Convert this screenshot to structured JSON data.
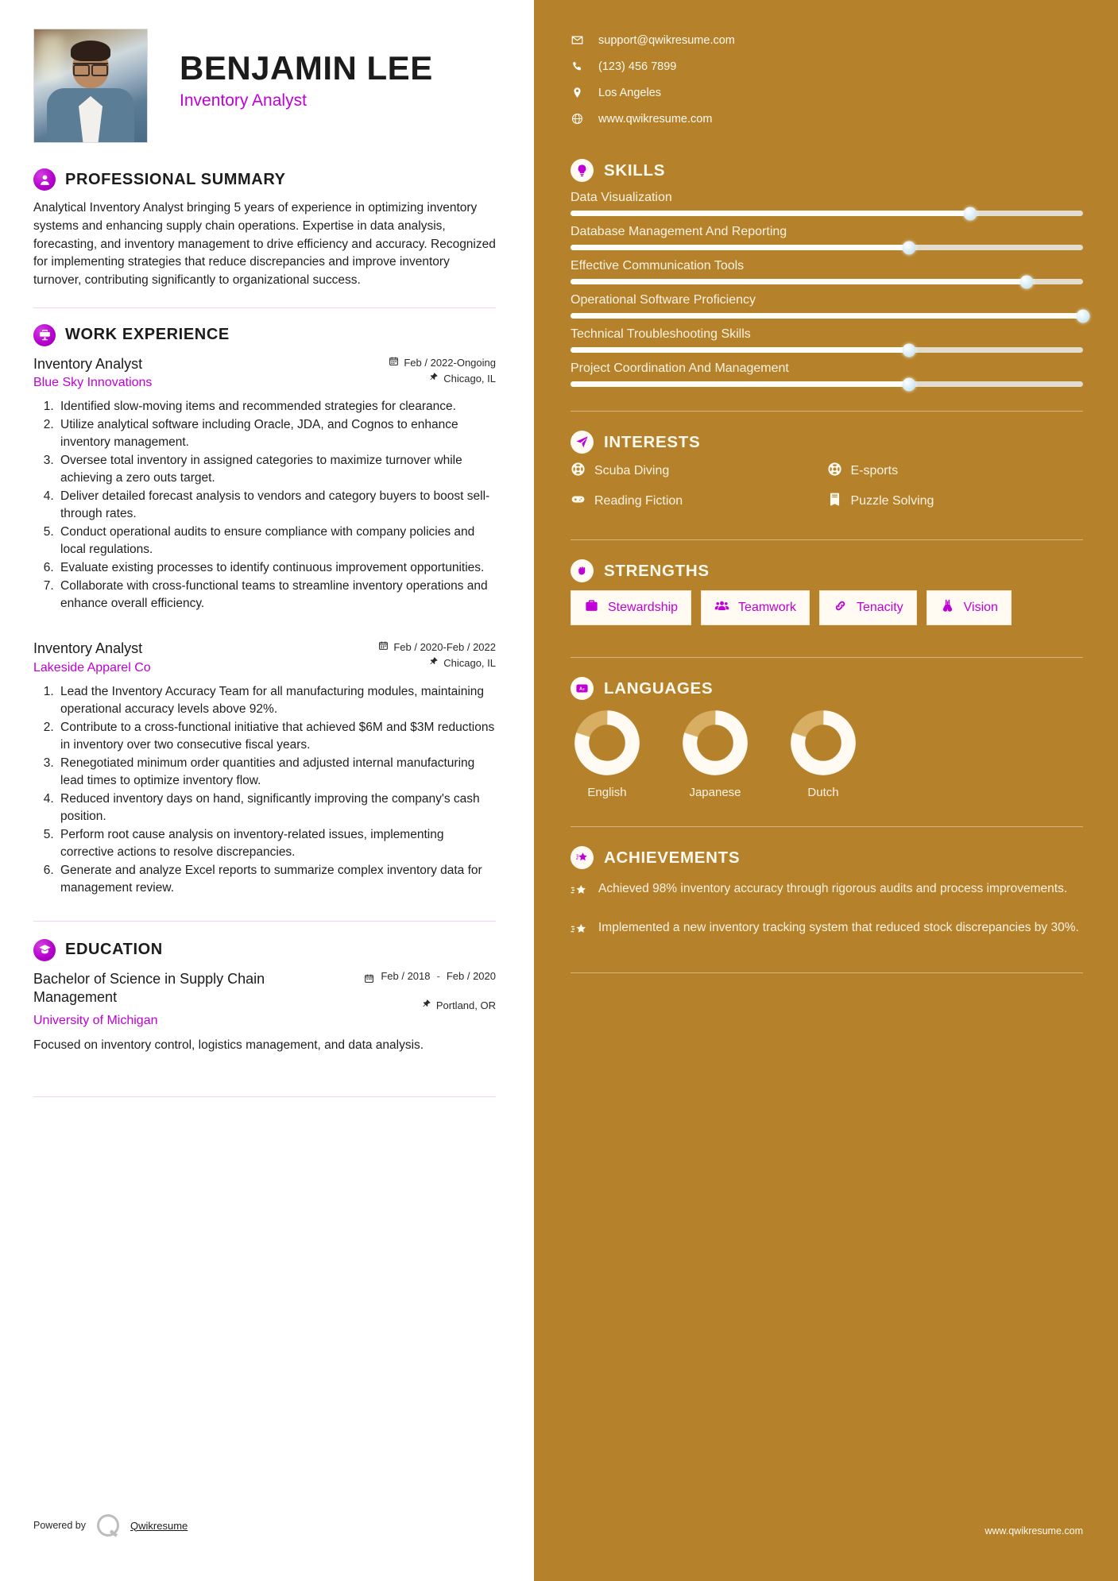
{
  "profile": {
    "name": "BENJAMIN LEE",
    "title": "Inventory Analyst",
    "photo_alt": "profile-photo"
  },
  "contact": {
    "items": [
      {
        "icon": "envelope-icon",
        "text": "support@qwikresume.com"
      },
      {
        "icon": "phone-icon",
        "text": "(123) 456 7899"
      },
      {
        "icon": "location-pin-icon",
        "text": "Los Angeles"
      },
      {
        "icon": "globe-icon",
        "text": "www.qwikresume.com"
      }
    ]
  },
  "summary": {
    "heading": "PROFESSIONAL SUMMARY",
    "icon": "user-icon",
    "text": "Analytical Inventory Analyst bringing 5 years of experience in optimizing inventory systems and enhancing supply chain operations. Expertise in data analysis, forecasting, and inventory management to drive efficiency and accuracy. Recognized for implementing strategies that reduce discrepancies and improve inventory turnover, contributing significantly to organizational success."
  },
  "work": {
    "heading": "WORK EXPERIENCE",
    "icon": "briefcase-icon",
    "jobs": [
      {
        "role": "Inventory Analyst",
        "company": "Blue Sky Innovations",
        "dates": "Feb / 2022-Ongoing",
        "location": "Chicago, IL",
        "bullets": [
          "Identified slow-moving items and recommended strategies for clearance.",
          "Utilize analytical software including Oracle, JDA, and Cognos to enhance inventory management.",
          "Oversee total inventory in assigned categories to maximize turnover while achieving a zero outs target.",
          "Deliver detailed forecast analysis to vendors and category buyers to boost sell-through rates.",
          "Conduct operational audits to ensure compliance with company policies and local regulations.",
          "Evaluate existing processes to identify continuous improvement opportunities.",
          "Collaborate with cross-functional teams to streamline inventory operations and enhance overall efficiency."
        ]
      },
      {
        "role": "Inventory Analyst",
        "company": "Lakeside Apparel Co",
        "dates": "Feb / 2020-Feb / 2022",
        "location": "Chicago, IL",
        "bullets": [
          "Lead the Inventory Accuracy Team for all manufacturing modules, maintaining operational accuracy levels above 92%.",
          "Contribute to a cross-functional initiative that achieved $6M and $3M reductions in inventory over two consecutive fiscal years.",
          "Renegotiated minimum order quantities and adjusted internal manufacturing lead times to optimize inventory flow.",
          "Reduced inventory days on hand, significantly improving the company's cash position.",
          "Perform root cause analysis on inventory-related issues, implementing corrective actions to resolve discrepancies.",
          "Generate and analyze Excel reports to summarize complex inventory data for management review."
        ]
      }
    ]
  },
  "education": {
    "heading": "EDUCATION",
    "icon": "graduation-icon",
    "degree": "Bachelor of Science in Supply Chain Management",
    "school": "University of Michigan",
    "date_start": "Feb / 2018",
    "date_end": "Feb / 2020",
    "location": "Portland, OR",
    "description": "Focused on inventory control, logistics management, and data analysis."
  },
  "skills": {
    "heading": "SKILLS",
    "icon": "lightbulb-icon",
    "items": [
      {
        "name": "Data Visualization",
        "level": 78
      },
      {
        "name": "Database Management And Reporting",
        "level": 66
      },
      {
        "name": "Effective Communication Tools",
        "level": 89
      },
      {
        "name": "Operational Software Proficiency",
        "level": 100
      },
      {
        "name": "Technical Troubleshooting Skills",
        "level": 66
      },
      {
        "name": "Project Coordination And Management",
        "level": 66
      }
    ]
  },
  "interests": {
    "heading": "INTERESTS",
    "icon": "paper-plane-icon",
    "items": [
      {
        "label": "Scuba Diving",
        "icon": "life-ring-icon"
      },
      {
        "label": "E-sports",
        "icon": "life-ring-icon"
      },
      {
        "label": "Reading Fiction",
        "icon": "gamepad-icon"
      },
      {
        "label": "Puzzle Solving",
        "icon": "book-icon"
      }
    ]
  },
  "strengths": {
    "heading": "STRENGTHS",
    "icon": "fist-icon",
    "items": [
      {
        "label": "Stewardship",
        "icon": "toolbox-icon"
      },
      {
        "label": "Teamwork",
        "icon": "users-icon"
      },
      {
        "label": "Tenacity",
        "icon": "chain-link-icon"
      },
      {
        "label": "Vision",
        "icon": "binoculars-icon"
      }
    ]
  },
  "languages": {
    "heading": "LANGUAGES",
    "icon": "translate-icon",
    "items": [
      {
        "label": "English",
        "level": 80
      },
      {
        "label": "Japanese",
        "level": 80
      },
      {
        "label": "Dutch",
        "level": 80
      }
    ]
  },
  "achievements": {
    "heading": "ACHIEVEMENTS",
    "icon": "star-badge-icon",
    "items": [
      {
        "text": "Achieved 98% inventory accuracy through rigorous audits and process improvements."
      },
      {
        "text": "Implemented a new inventory tracking system that reduced stock discrepancies by 30%."
      }
    ]
  },
  "footer": {
    "powered_by": "Powered by",
    "brand": "Qwikresume",
    "site": "www.qwikresume.com"
  },
  "colors": {
    "accent": "#bf00d6",
    "sidebar": "#b5812a",
    "text": "#1b1b1b"
  }
}
